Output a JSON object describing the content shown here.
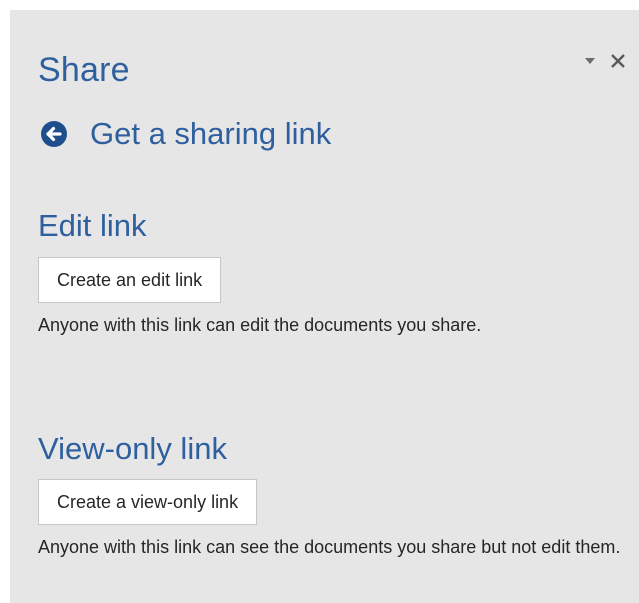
{
  "pane": {
    "title": "Share",
    "dropdown_icon": "chevron-down-icon",
    "close_icon": "close-icon"
  },
  "back": {
    "icon": "back-arrow-icon",
    "label": "Get a sharing link"
  },
  "edit_section": {
    "heading": "Edit link",
    "button_label": "Create an edit link",
    "description": "Anyone with this link can edit the documents you share."
  },
  "view_section": {
    "heading": "View-only link",
    "button_label": "Create a view-only link",
    "description": "Anyone with this link can see the documents you share but not edit them."
  },
  "colors": {
    "accent": "#2e5f9e",
    "pane_background": "#e6e6e6",
    "back_icon": "#1e4e8c"
  }
}
